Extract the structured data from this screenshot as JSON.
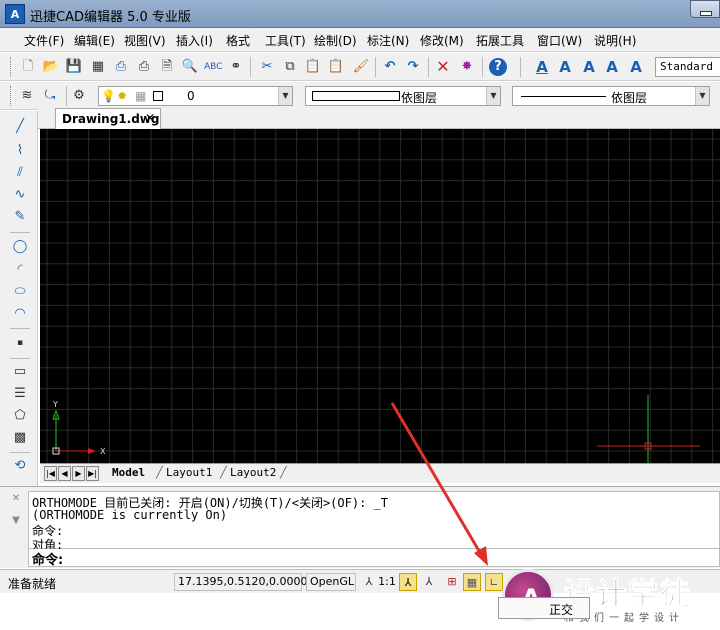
{
  "window": {
    "title": "迅捷CAD编辑器 5.0 专业版",
    "icon": "cad-app-icon",
    "icon_text": "A"
  },
  "menu": [
    "文件(F)",
    "编辑(E)",
    "视图(V)",
    "插入(I)",
    "格式",
    "工具(T)",
    "绘制(D)",
    "标注(N)",
    "修改(M)",
    "拓展工具",
    "窗口(W)",
    "说明(H)"
  ],
  "toolbar1": {
    "icons": [
      "new-icon",
      "open-icon",
      "save-icon",
      "saveas-icon",
      "print-icon",
      "print-preview-icon",
      "plot-icon",
      "find-icon",
      "spellcheck-icon",
      "binoculars-icon",
      "cut-icon",
      "copy-icon",
      "paste-icon",
      "paste-special-icon",
      "match-properties-icon",
      "undo-icon",
      "redo-icon",
      "delete-icon",
      "erase-icon",
      "help-icon",
      "text-style-icon",
      "text-icon",
      "text-edit-icon",
      "text-format-icon",
      "text-find-icon"
    ],
    "spellcheck_text": "ABC",
    "text_style": "Standard"
  },
  "toolbar2": {
    "layer_value": "0",
    "color_value": "依图层",
    "linetype_value": "依图层"
  },
  "doc_tab": {
    "label": "Drawing1.dwg",
    "close": "✕"
  },
  "canvas": {
    "axis_y": "Y",
    "axis_x": "X"
  },
  "layout_tabs": [
    "Model",
    "Layout1",
    "Layout2"
  ],
  "command": {
    "lines": [
      "ORTHOMODE 目前已关闭: 开启(ON)/切换(T)/<关闭>(OF): _T",
      "(ORTHOMODE is currently On)",
      "命令:",
      "对角:"
    ],
    "prompt": "命令:"
  },
  "statusbar": {
    "ready": "准备就绪",
    "coords": "17.1395,0.5120,0.0000",
    "renderer": "OpenGL",
    "scale": "1:1",
    "tooltip": "正交"
  },
  "watermark": {
    "title": "设计学徒",
    "sub": "和我们一起学设计",
    "letter": "A"
  },
  "colors": {
    "accent": "#1a5fb4",
    "arrow": "#e0302a",
    "canvas_bg": "#000000"
  }
}
